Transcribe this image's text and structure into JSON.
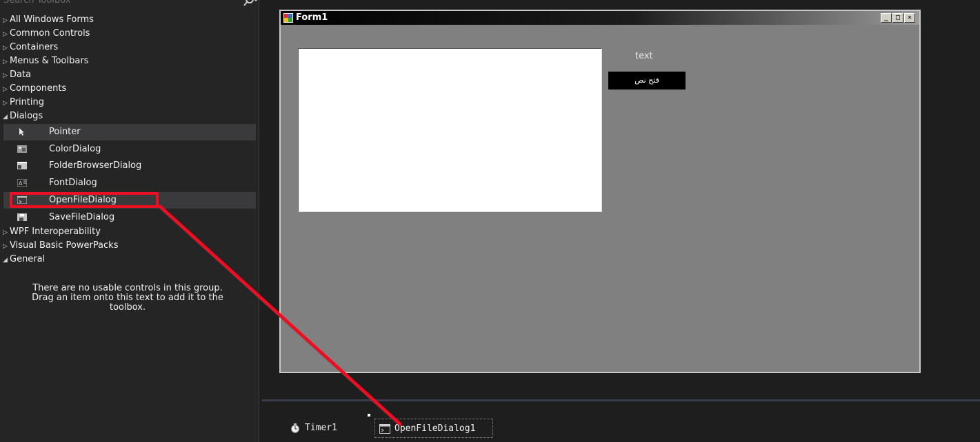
{
  "toolbox": {
    "search_placeholder": "Search Toolbox",
    "categories_top": [
      {
        "arrow": "▷",
        "label": "All Windows Forms"
      },
      {
        "arrow": "▷",
        "label": "Common Controls"
      },
      {
        "arrow": "▷",
        "label": "Containers"
      },
      {
        "arrow": "▷",
        "label": "Menus & Toolbars"
      },
      {
        "arrow": "▷",
        "label": "Data"
      },
      {
        "arrow": "▷",
        "label": "Components"
      },
      {
        "arrow": "▷",
        "label": "Printing"
      },
      {
        "arrow": "◢",
        "label": "Dialogs"
      }
    ],
    "dialog_items": [
      {
        "label": "Pointer",
        "icon": "pointer-icon"
      },
      {
        "label": "ColorDialog",
        "icon": "color-dialog-icon"
      },
      {
        "label": "FolderBrowserDialog",
        "icon": "folder-browser-dialog-icon"
      },
      {
        "label": "FontDialog",
        "icon": "font-dialog-icon"
      },
      {
        "label": "OpenFileDialog",
        "icon": "open-file-dialog-icon"
      },
      {
        "label": "SaveFileDialog",
        "icon": "save-file-dialog-icon"
      }
    ],
    "categories_bottom": [
      {
        "arrow": "▷",
        "label": "WPF Interoperability"
      },
      {
        "arrow": "▷",
        "label": "Visual Basic PowerPacks"
      },
      {
        "arrow": "◢",
        "label": "General"
      }
    ],
    "general_empty_line1": "There are no usable controls in this group.",
    "general_empty_line2": "Drag an item onto this text to add it to the",
    "general_empty_line3": "toolbox."
  },
  "form": {
    "title": "Form1",
    "minimize": "_",
    "maximize": "□",
    "close": "✕",
    "label_text": "text",
    "button_text": "فتح نص"
  },
  "tray": {
    "items": [
      {
        "label": "Timer1",
        "icon": "timer-icon"
      },
      {
        "label": "OpenFileDialog1",
        "icon": "open-file-dialog-icon"
      }
    ]
  },
  "colors": {
    "accent_annotation": "#e81123",
    "form_background": "#808080",
    "ide_background": "#1e1e1e"
  }
}
